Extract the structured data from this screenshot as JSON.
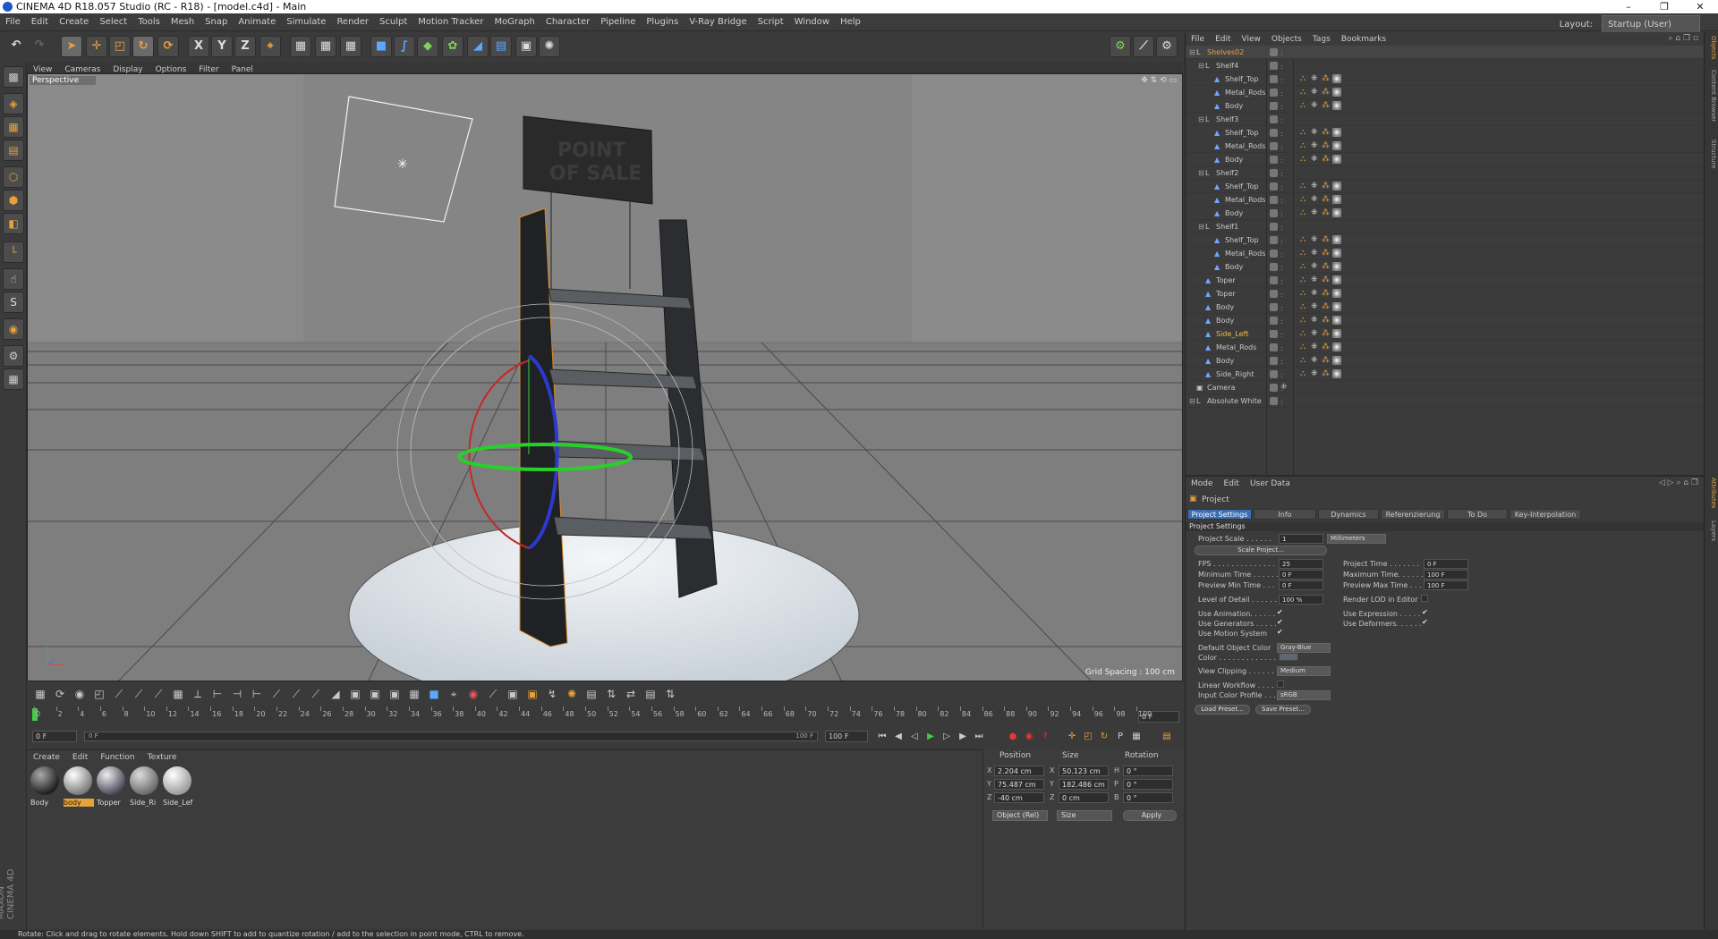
{
  "window": {
    "title": "CINEMA 4D R18.057 Studio (RC - R18) - [model.c4d] - Main",
    "minimize": "–",
    "maximize": "❐",
    "close": "✕"
  },
  "menubar": {
    "items": [
      "File",
      "Edit",
      "Create",
      "Select",
      "Tools",
      "Mesh",
      "Snap",
      "Animate",
      "Simulate",
      "Render",
      "Sculpt",
      "Motion Tracker",
      "MoGraph",
      "Character",
      "Pipeline",
      "Plugins",
      "V-Ray Bridge",
      "Script",
      "Window",
      "Help"
    ],
    "layout_label": "Layout:",
    "layout_value": "Startup (User)"
  },
  "viewport": {
    "menu": [
      "View",
      "Cameras",
      "Display",
      "Options",
      "Filter",
      "Panel"
    ],
    "label": "Perspective",
    "grid_spacing": "Grid Spacing : 100 cm",
    "sign_text_1": "POINT",
    "sign_text_2": "OF SALE"
  },
  "timeline": {
    "ticks": [
      "0",
      "2",
      "4",
      "6",
      "8",
      "10",
      "12",
      "14",
      "16",
      "18",
      "20",
      "22",
      "24",
      "26",
      "28",
      "30",
      "32",
      "34",
      "36",
      "38",
      "40",
      "42",
      "44",
      "46",
      "48",
      "50",
      "52",
      "54",
      "56",
      "58",
      "60",
      "62",
      "64",
      "66",
      "68",
      "70",
      "72",
      "74",
      "76",
      "78",
      "80",
      "82",
      "84",
      "86",
      "88",
      "90",
      "92",
      "94",
      "96",
      "98",
      "100"
    ],
    "current_frame_right": "0 F",
    "start_field": "0 F",
    "slider_start": "0 F",
    "slider_end": "100 F",
    "end_field": "100 F"
  },
  "materials": {
    "menu": [
      "Create",
      "Edit",
      "Function",
      "Texture"
    ],
    "items": [
      {
        "label": "Body"
      },
      {
        "label": "body"
      },
      {
        "label": "Topper"
      },
      {
        "label": "Side_Ri"
      },
      {
        "label": "Side_Lef"
      }
    ]
  },
  "coords": {
    "headers": [
      "Position",
      "Size",
      "Rotation"
    ],
    "rows": [
      {
        "axis": "X",
        "pos": "2.204 cm",
        "size_axis": "X",
        "size": "50.123 cm",
        "rot_axis": "H",
        "rot": "0 °"
      },
      {
        "axis": "Y",
        "pos": "75.487 cm",
        "size_axis": "Y",
        "size": "182.486 cm",
        "rot_axis": "P",
        "rot": "0 °"
      },
      {
        "axis": "Z",
        "pos": "-40 cm",
        "size_axis": "Z",
        "size": "0 cm",
        "rot_axis": "B",
        "rot": "0 °"
      }
    ],
    "mode": "Object (Rel)",
    "size_mode": "Size",
    "apply": "Apply"
  },
  "status": "Rotate: Click and drag to rotate elements. Hold down SHIFT to add to quantize rotation / add to the selection in point mode, CTRL to remove.",
  "objects": {
    "menu": [
      "File",
      "Edit",
      "View",
      "Objects",
      "Tags",
      "Bookmarks"
    ],
    "rows": [
      {
        "name": "Shelves02",
        "indent": 0,
        "type": "null",
        "selected": true
      },
      {
        "name": "Shelf4",
        "indent": 1,
        "type": "null"
      },
      {
        "name": "Shelf_Top",
        "indent": 2,
        "type": "poly"
      },
      {
        "name": "Metal_Rods",
        "indent": 2,
        "type": "poly"
      },
      {
        "name": "Body",
        "indent": 2,
        "type": "poly"
      },
      {
        "name": "Shelf3",
        "indent": 1,
        "type": "null"
      },
      {
        "name": "Shelf_Top",
        "indent": 2,
        "type": "poly"
      },
      {
        "name": "Metal_Rods",
        "indent": 2,
        "type": "poly"
      },
      {
        "name": "Body",
        "indent": 2,
        "type": "poly"
      },
      {
        "name": "Shelf2",
        "indent": 1,
        "type": "null"
      },
      {
        "name": "Shelf_Top",
        "indent": 2,
        "type": "poly"
      },
      {
        "name": "Metal_Rods",
        "indent": 2,
        "type": "poly"
      },
      {
        "name": "Body",
        "indent": 2,
        "type": "poly"
      },
      {
        "name": "Shelf1",
        "indent": 1,
        "type": "null"
      },
      {
        "name": "Shelf_Top",
        "indent": 2,
        "type": "poly"
      },
      {
        "name": "Metal_Rods",
        "indent": 2,
        "type": "poly"
      },
      {
        "name": "Body",
        "indent": 2,
        "type": "poly"
      },
      {
        "name": "Toper",
        "indent": 1,
        "type": "poly"
      },
      {
        "name": "Toper",
        "indent": 1,
        "type": "poly"
      },
      {
        "name": "Body",
        "indent": 1,
        "type": "poly"
      },
      {
        "name": "Body",
        "indent": 1,
        "type": "poly"
      },
      {
        "name": "Side_Left",
        "indent": 1,
        "type": "poly",
        "highlight": true
      },
      {
        "name": "Metal_Rods",
        "indent": 1,
        "type": "poly"
      },
      {
        "name": "Body",
        "indent": 1,
        "type": "poly"
      },
      {
        "name": "Side_Right",
        "indent": 1,
        "type": "poly"
      },
      {
        "name": "Camera",
        "indent": 0,
        "type": "camera"
      },
      {
        "name": "Absolute White",
        "indent": 0,
        "type": "null"
      }
    ]
  },
  "attributes": {
    "menu": [
      "Mode",
      "Edit",
      "User Data"
    ],
    "object_label": "Project",
    "tabs": [
      "Project Settings",
      "Info",
      "Dynamics",
      "Referenzierung",
      "To Do",
      "Key-Interpolation"
    ],
    "section": "Project Settings",
    "project_scale_label": "Project Scale . . . . . .",
    "project_scale": "1",
    "scale_unit": "Millimeters",
    "scale_project_btn": "Scale Project...",
    "fps_label": "FPS . . . . . . . . . . . . . .",
    "fps": "25",
    "project_time_label": "Project Time . . . . . . .",
    "project_time": "0 F",
    "min_time_label": "Minimum Time . . . . . .",
    "min_time": "0 F",
    "max_time_label": "Maximum Time. . . . . .",
    "max_time": "100 F",
    "preview_min_label": "Preview Min Time . . .",
    "preview_min": "0 F",
    "preview_max_label": "Preview Max Time . . .",
    "preview_max": "100 F",
    "lod_label": "Level of Detail . . . . . .",
    "lod": "100 %",
    "render_lod_label": "Render LOD in Editor",
    "use_anim_label": "Use Animation. . . . . .",
    "use_expr_label": "Use Expression . . . . .",
    "use_gen_label": "Use Generators . . . . .",
    "use_deform_label": "Use Deformers. . . . . .",
    "use_motion_label": "Use Motion System",
    "def_color_label": "Default Object Color",
    "def_color": "Gray-Blue",
    "color_label": "Color . . . . . . . . . . . . .",
    "view_clip_label": "View Clipping . . . . . .",
    "view_clip": "Medium",
    "linear_label": "Linear Workflow . . . . .",
    "input_profile_label": "Input Color Profile . . .",
    "input_profile": "sRGB",
    "load_preset": "Load Preset...",
    "save_preset": "Save Preset..."
  },
  "right_tabs": [
    "Objects",
    "Content Browser",
    "Structure"
  ],
  "right_tabs_lower": [
    "Attributes",
    "Layers"
  ],
  "colors": {
    "accent_orange": "#e8a23a",
    "selection_blue": "#3b6db4"
  }
}
